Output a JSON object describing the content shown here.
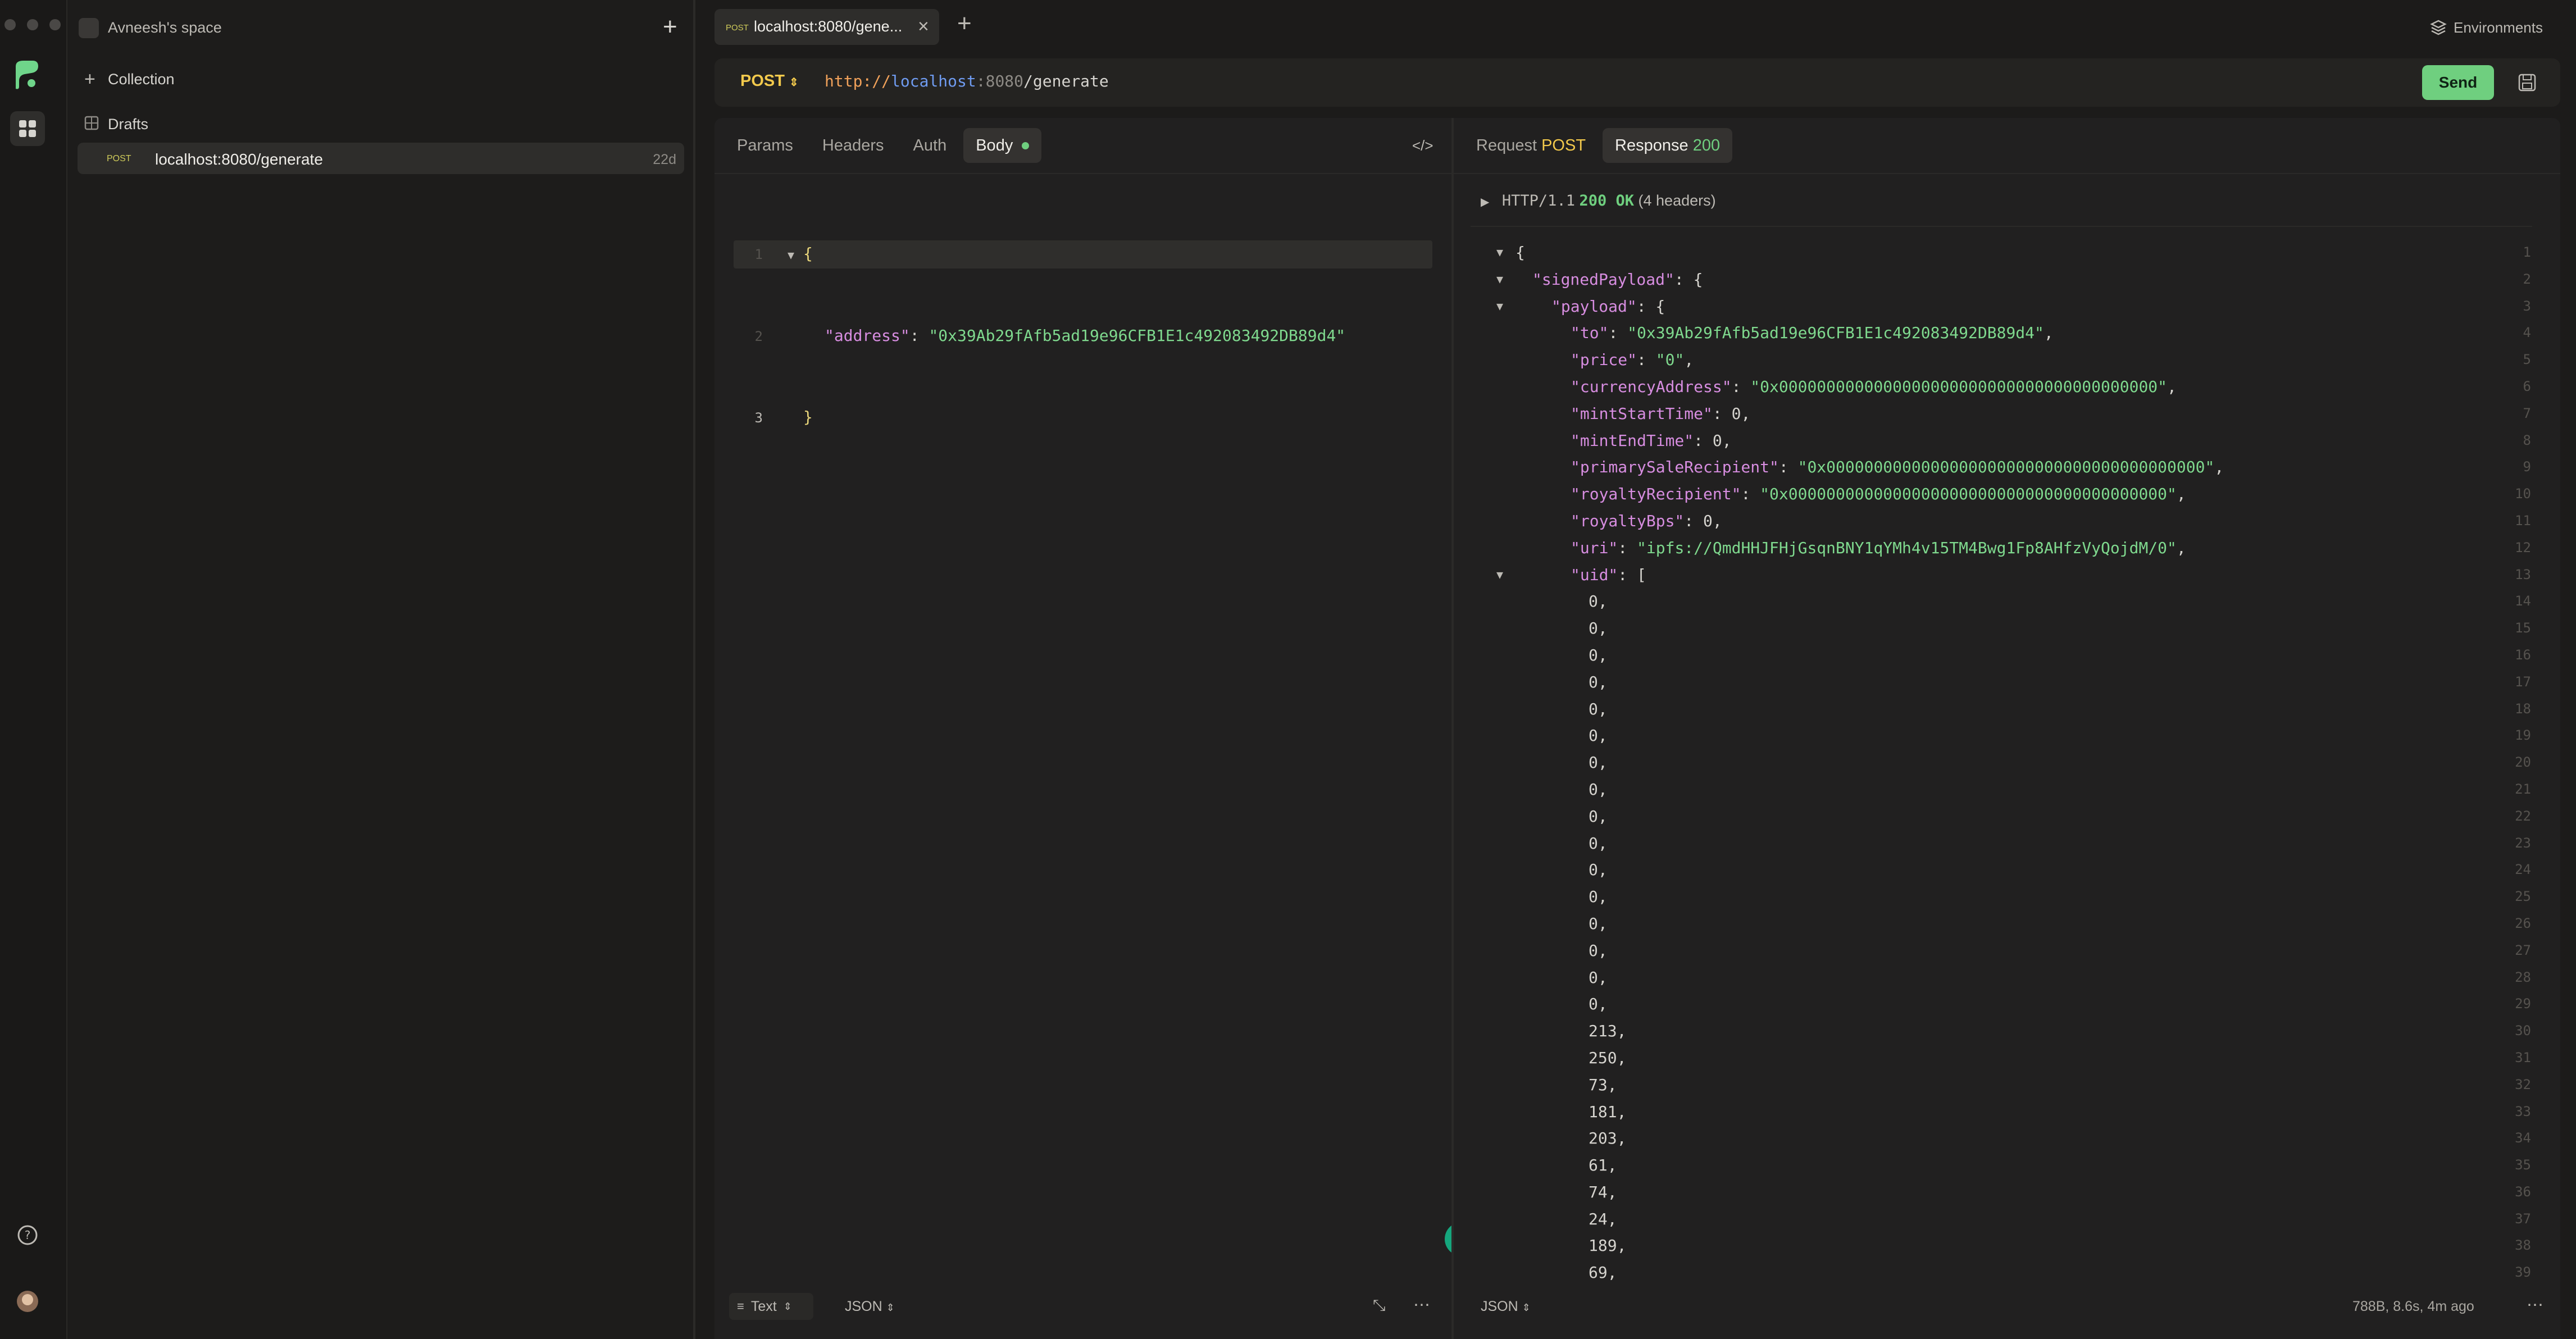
{
  "colors": {
    "accent": "#7fd98e",
    "method": "#f2c94c",
    "send_bg": "#6fcf7f"
  },
  "sidebar": {
    "workspace": "Avneesh's space",
    "collection_label": "Collection",
    "drafts_label": "Drafts",
    "item": {
      "method": "POST",
      "url": "localhost:8080/generate",
      "age": "22d"
    }
  },
  "tab": {
    "method": "POST",
    "title": "localhost:8080/gene..."
  },
  "environments_label": "Environments",
  "request": {
    "method": "POST",
    "url": {
      "scheme": "http://",
      "host": "localhost",
      "port": ":8080",
      "path": "/generate"
    },
    "send_label": "Send",
    "tabs": [
      "Params",
      "Headers",
      "Auth",
      "Body"
    ],
    "body_lines": [
      {
        "n": "1",
        "text": "{"
      },
      {
        "n": "2",
        "key": "\"address\"",
        "sep": ": ",
        "value": "\"0x39Ab29fAfb5ad19e96CFB1E1c492083492DB89d4\""
      },
      {
        "n": "3",
        "text": "}"
      }
    ],
    "footer": {
      "text_mode": "Text",
      "format": "JSON"
    }
  },
  "response": {
    "request_tab": "Request",
    "request_method": "POST",
    "response_tab": "Response",
    "status_code": "200",
    "http_summary": {
      "proto": "HTTP/1.1",
      "status": "200 OK",
      "headers": "(4 headers)"
    },
    "lines": [
      {
        "n": "1",
        "indent": 0,
        "toggle": true,
        "text": "{"
      },
      {
        "n": "2",
        "indent": 1,
        "toggle": true,
        "key": "\"signedPayload\"",
        "rest": ": {"
      },
      {
        "n": "3",
        "indent": 2,
        "toggle": true,
        "key": "\"payload\"",
        "rest": ": {"
      },
      {
        "n": "4",
        "indent": 3,
        "key": "\"to\"",
        "sep": ": ",
        "str": "\"0x39Ab29fAfb5ad19e96CFB1E1c492083492DB89d4\"",
        "tail": ","
      },
      {
        "n": "5",
        "indent": 3,
        "key": "\"price\"",
        "sep": ": ",
        "str": "\"0\"",
        "tail": ","
      },
      {
        "n": "6",
        "indent": 3,
        "key": "\"currencyAddress\"",
        "sep": ": ",
        "str": "\"0x0000000000000000000000000000000000000000\"",
        "tail": ","
      },
      {
        "n": "7",
        "indent": 3,
        "key": "\"mintStartTime\"",
        "sep": ": ",
        "num": "0",
        "tail": ","
      },
      {
        "n": "8",
        "indent": 3,
        "key": "\"mintEndTime\"",
        "sep": ": ",
        "num": "0",
        "tail": ","
      },
      {
        "n": "9",
        "indent": 3,
        "key": "\"primarySaleRecipient\"",
        "sep": ": ",
        "str": "\"0x0000000000000000000000000000000000000000\"",
        "tail": ","
      },
      {
        "n": "10",
        "indent": 3,
        "key": "\"royaltyRecipient\"",
        "sep": ": ",
        "str": "\"0x0000000000000000000000000000000000000000\"",
        "tail": ","
      },
      {
        "n": "11",
        "indent": 3,
        "key": "\"royaltyBps\"",
        "sep": ": ",
        "num": "0",
        "tail": ","
      },
      {
        "n": "12",
        "indent": 3,
        "key": "\"uri\"",
        "sep": ": ",
        "str": "\"ipfs://QmdHHJFHjGsqnBNY1qYMh4v15TM4Bwg1Fp8AHfzVyQojdM/0\"",
        "tail": ","
      },
      {
        "n": "13",
        "indent": 3,
        "toggle": true,
        "key": "\"uid\"",
        "rest": ": ["
      },
      {
        "n": "14",
        "indent": 4,
        "num": "0",
        "tail": ","
      },
      {
        "n": "15",
        "indent": 4,
        "num": "0",
        "tail": ","
      },
      {
        "n": "16",
        "indent": 4,
        "num": "0",
        "tail": ","
      },
      {
        "n": "17",
        "indent": 4,
        "num": "0",
        "tail": ","
      },
      {
        "n": "18",
        "indent": 4,
        "num": "0",
        "tail": ","
      },
      {
        "n": "19",
        "indent": 4,
        "num": "0",
        "tail": ","
      },
      {
        "n": "20",
        "indent": 4,
        "num": "0",
        "tail": ","
      },
      {
        "n": "21",
        "indent": 4,
        "num": "0",
        "tail": ","
      },
      {
        "n": "22",
        "indent": 4,
        "num": "0",
        "tail": ","
      },
      {
        "n": "23",
        "indent": 4,
        "num": "0",
        "tail": ","
      },
      {
        "n": "24",
        "indent": 4,
        "num": "0",
        "tail": ","
      },
      {
        "n": "25",
        "indent": 4,
        "num": "0",
        "tail": ","
      },
      {
        "n": "26",
        "indent": 4,
        "num": "0",
        "tail": ","
      },
      {
        "n": "27",
        "indent": 4,
        "num": "0",
        "tail": ","
      },
      {
        "n": "28",
        "indent": 4,
        "num": "0",
        "tail": ","
      },
      {
        "n": "29",
        "indent": 4,
        "num": "0",
        "tail": ","
      },
      {
        "n": "30",
        "indent": 4,
        "num": "213",
        "tail": ","
      },
      {
        "n": "31",
        "indent": 4,
        "num": "250",
        "tail": ","
      },
      {
        "n": "32",
        "indent": 4,
        "num": "73",
        "tail": ","
      },
      {
        "n": "33",
        "indent": 4,
        "num": "181",
        "tail": ","
      },
      {
        "n": "34",
        "indent": 4,
        "num": "203",
        "tail": ","
      },
      {
        "n": "35",
        "indent": 4,
        "num": "61",
        "tail": ","
      },
      {
        "n": "36",
        "indent": 4,
        "num": "74",
        "tail": ","
      },
      {
        "n": "37",
        "indent": 4,
        "num": "24",
        "tail": ","
      },
      {
        "n": "38",
        "indent": 4,
        "num": "189",
        "tail": ","
      },
      {
        "n": "39",
        "indent": 4,
        "num": "69",
        "tail": ","
      }
    ],
    "footer": {
      "format": "JSON",
      "stats": "788B, 8.6s, 4m ago"
    }
  }
}
